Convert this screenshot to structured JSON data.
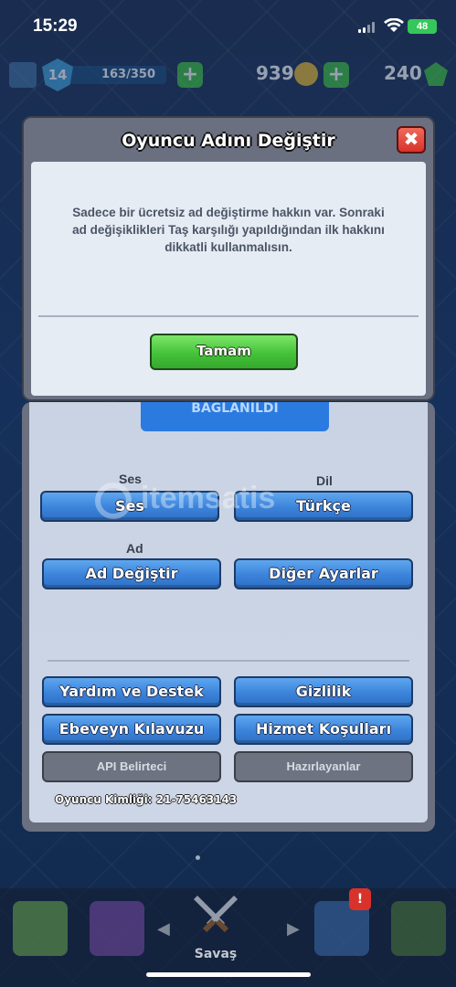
{
  "status_bar": {
    "time": "15:29",
    "battery": "48"
  },
  "resource_bar": {
    "level": "14",
    "xp": "163/350",
    "gold": "939",
    "gems": "240"
  },
  "modal": {
    "title": "Oyuncu Adını Değiştir",
    "close_label": "✖",
    "message": "Sadece bir ücretsiz ad değiştirme hakkın var. Sonraki ad değişiklikleri Taş karşılığı yapıldığından ilk hakkını dikkatli kullanmalısın.",
    "ok_label": "Tamam"
  },
  "settings": {
    "connected_label": "BAĞLANILDI",
    "sound": {
      "section": "Ses",
      "button": "Ses"
    },
    "language": {
      "section": "Dil",
      "button": "Türkçe"
    },
    "name": {
      "section": "Ad",
      "button": "Ad Değiştir"
    },
    "other_settings": "Diğer Ayarlar",
    "help": "Yardım ve Destek",
    "privacy": "Gizlilik",
    "parents_guide": "Ebeveyn Kılavuzu",
    "terms": "Hizmet Koşulları",
    "api_token": "API Belirteci",
    "credits": "Hazırlayanlar",
    "player_id": "Oyuncu Kimliği: 21-75463143"
  },
  "watermark": "itemsatis",
  "bottom_nav": {
    "battle_label": "Savaş",
    "clan_notification": "!"
  }
}
